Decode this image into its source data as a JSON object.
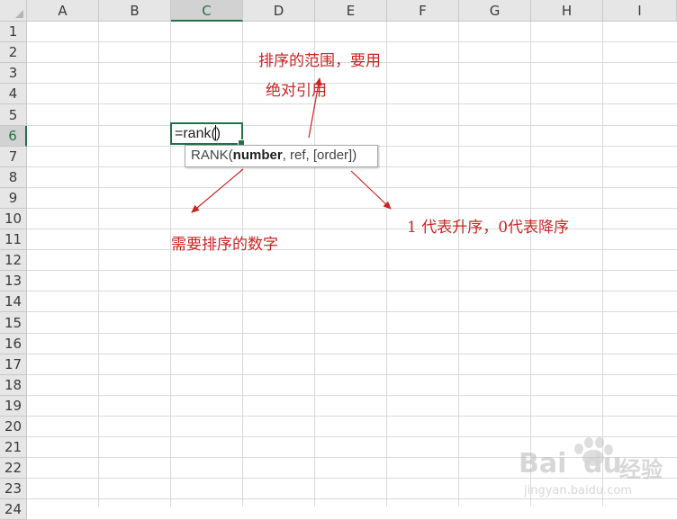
{
  "columns": [
    "A",
    "B",
    "C",
    "D",
    "E",
    "F",
    "G",
    "H",
    "I"
  ],
  "rows": [
    "1",
    "2",
    "3",
    "4",
    "5",
    "6",
    "7",
    "8",
    "9",
    "10",
    "11",
    "12",
    "13",
    "14",
    "15",
    "16",
    "17",
    "18",
    "19",
    "20",
    "21",
    "22",
    "23",
    "24"
  ],
  "selected_column": "C",
  "selected_row": "6",
  "active_cell": {
    "ref": "C6",
    "value": "=rank("
  },
  "tooltip": {
    "func": "RANK(",
    "arg1": "number",
    "rest": ", ref, [order])"
  },
  "annotations": {
    "ref_line1": "排序的范围，要用",
    "ref_line2": "绝对引用",
    "number_note": "需要排序的数字",
    "order_note": "1 代表升序，0代表降序"
  },
  "colors": {
    "accent": "#217346",
    "annotation": "#cc2222",
    "grid": "#dadada",
    "header_bg": "#e6e6e6"
  },
  "watermark": {
    "brand": "Bai",
    "brand2": "du",
    "sub": "经验",
    "url": "jingyan.baidu.com"
  }
}
